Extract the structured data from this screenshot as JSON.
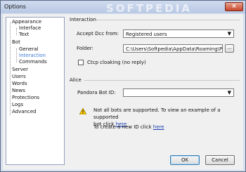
{
  "window": {
    "title": "Options",
    "watermark": "SOFTPEDIA",
    "close_glyph": "×"
  },
  "tree": {
    "items": [
      {
        "label": "Appearance",
        "level": 0,
        "selected": false
      },
      {
        "label": "Interface",
        "level": 1,
        "selected": false
      },
      {
        "label": "Text",
        "level": 1,
        "selected": false
      },
      {
        "label": "Bot",
        "level": 0,
        "selected": false
      },
      {
        "label": "General",
        "level": 1,
        "selected": false
      },
      {
        "label": "Interaction",
        "level": 1,
        "selected": true
      },
      {
        "label": "Commands",
        "level": 1,
        "selected": false
      },
      {
        "label": "Server",
        "level": 0,
        "selected": false
      },
      {
        "label": "Users",
        "level": 0,
        "selected": false
      },
      {
        "label": "Words",
        "level": 0,
        "selected": false
      },
      {
        "label": "News",
        "level": 0,
        "selected": false
      },
      {
        "label": "Protections",
        "level": 0,
        "selected": false
      },
      {
        "label": "Logs",
        "level": 0,
        "selected": false
      },
      {
        "label": "Advanced",
        "level": 0,
        "selected": false
      }
    ]
  },
  "interaction": {
    "section_title": "Interaction",
    "accept_dcc_label": "Accept Dcc from:",
    "accept_dcc_value": "Registered users",
    "folder_label": "Folder:",
    "folder_value": "C:\\Users\\Softpedia\\AppData\\Roaming\\Pmo",
    "browse_label": "...",
    "ctcp_label": "Ctcp cloaking (no reply)"
  },
  "alice": {
    "section_title": "Alice",
    "bot_id_label": "Pandora Bot ID:",
    "bot_id_value": "",
    "note_line1": "Not all bots are supported. To view an example of a supported",
    "note_line2_prefix": "bot click ",
    "note_link": "here",
    "create_prefix": "To create a new ID click ",
    "create_link": "here"
  },
  "buttons": {
    "ok": "OK",
    "cancel": "Cancel"
  },
  "colors": {
    "selected": "#3c78d8",
    "link": "#1a3fb0",
    "title_bar": "#b9c9e4"
  }
}
